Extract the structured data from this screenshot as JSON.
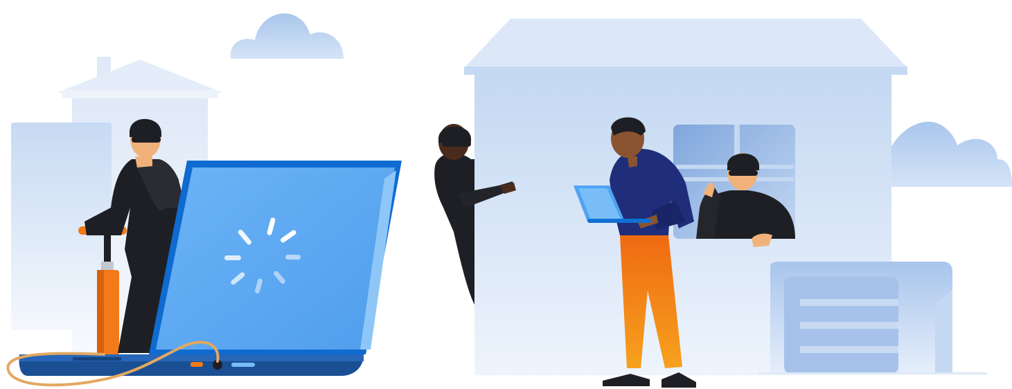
{
  "scene": {
    "background": "#ffffff",
    "palette": {
      "sky_blue": "#dbe7f7",
      "house_blue": "#c9dcf3",
      "laptop_screen": "#5ba9f3",
      "laptop_frame": "#0f6bd0",
      "laptop_base": "#1b4f93",
      "mask_black": "#1e1f24",
      "pants_orange": "#f37515",
      "hoodie_navy": "#1f2d7a",
      "cable_tan": "#e3a861",
      "pump_orange": "#f27a18"
    },
    "elements": [
      "cloud-icon",
      "house-icon",
      "laptop-icon",
      "loading-spinner-icon",
      "bicycle-pump-icon",
      "masked-thief-figure",
      "person-with-laptop-figure",
      "window-icon",
      "garage-door-icon"
    ]
  }
}
